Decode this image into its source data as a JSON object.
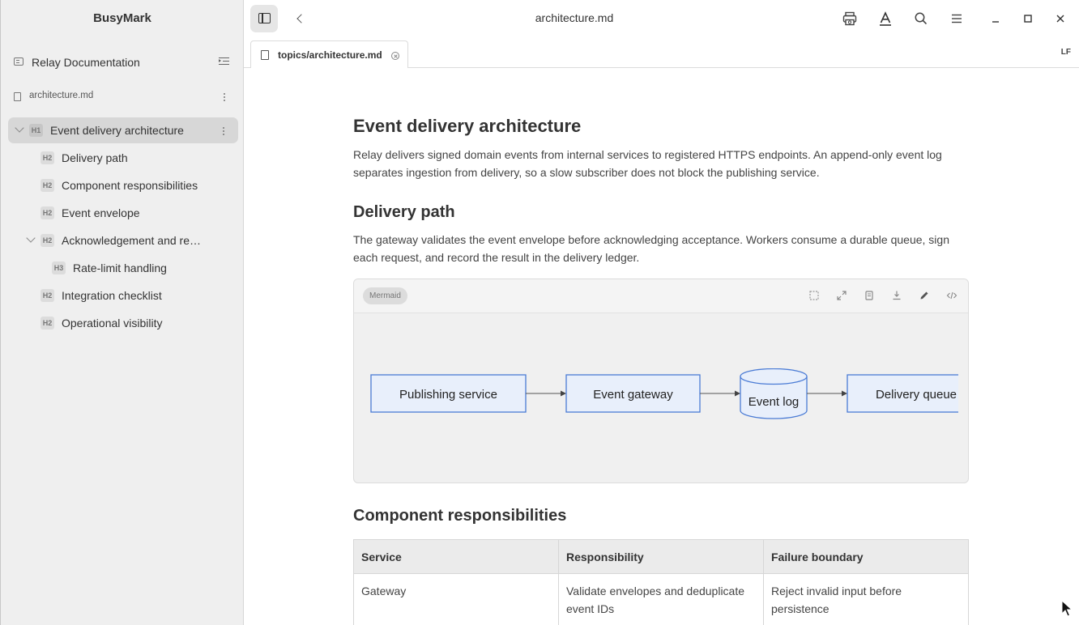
{
  "app": {
    "name": "BusyMark"
  },
  "sidebar": {
    "workspace": "Relay Documentation",
    "file": "architecture.md",
    "outline": [
      {
        "level": "H1",
        "label": "Event delivery architecture",
        "expanded": true,
        "active": true
      },
      {
        "level": "H2",
        "label": "Delivery path"
      },
      {
        "level": "H2",
        "label": "Component responsibilities"
      },
      {
        "level": "H2",
        "label": "Event envelope"
      },
      {
        "level": "H2",
        "label": "Acknowledgement and re…",
        "expanded": true
      },
      {
        "level": "H3",
        "label": "Rate-limit handling"
      },
      {
        "level": "H2",
        "label": "Integration checklist"
      },
      {
        "level": "H2",
        "label": "Operational visibility"
      }
    ]
  },
  "topbar": {
    "title": "architecture.md"
  },
  "tab": {
    "label": "topics/architecture.md",
    "line_ending": "LF"
  },
  "document": {
    "title": "Event delivery architecture",
    "intro": "Relay delivers signed domain events from internal services to registered HTTPS endpoints. An append-only event log separates ingestion from delivery, so a slow subscriber does not block the publishing service.",
    "section1": {
      "heading": "Delivery path",
      "text": "The gateway validates the event envelope before acknowledging acceptance. Workers consume a durable queue, sign each request, and record the result in the delivery ledger."
    },
    "mermaid": {
      "badge": "Mermaid",
      "nodes": [
        "Publishing service",
        "Event gateway",
        "Event log",
        "Delivery queue"
      ]
    },
    "section2": {
      "heading": "Component responsibilities",
      "table": {
        "headers": [
          "Service",
          "Responsibility",
          "Failure boundary"
        ],
        "rows": [
          [
            "Gateway",
            "Validate envelopes and deduplicate event IDs",
            "Reject invalid input before persistence"
          ]
        ]
      }
    }
  },
  "colors": {
    "sidebar_bg": "#efefef",
    "node_fill": "#e8effb",
    "node_stroke": "#4a7bd5"
  }
}
